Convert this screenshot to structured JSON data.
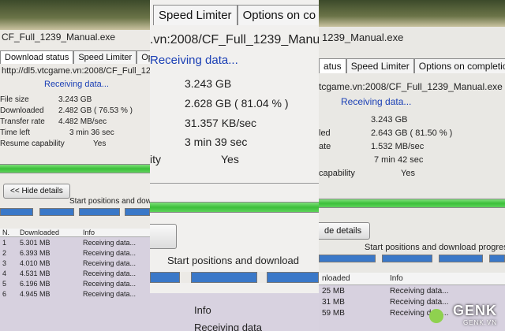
{
  "left": {
    "title": "CF_Full_1239_Manual.exe",
    "tabs": [
      "Download status",
      "Speed Limiter",
      "Options on completion"
    ],
    "url": "http://dl5.vtcgame.vn:2008/CF_Full_1239_Manual",
    "status": "Receiving data...",
    "rows": [
      {
        "label": "File size",
        "value": "3.243 GB"
      },
      {
        "label": "Downloaded",
        "value": "2.482 GB ( 76.53 % )"
      },
      {
        "label": "Transfer rate",
        "value": "4.482 MB/sec"
      },
      {
        "label": "Time left",
        "value": "3 min 36 sec"
      },
      {
        "label": "Resume capability",
        "value": "Yes"
      }
    ],
    "hide_details": "<< Hide details",
    "start_positions": "Start positions and download",
    "table_headers": [
      "N.",
      "Downloaded",
      "Info"
    ],
    "table_rows": [
      {
        "n": "1",
        "downloaded": "5.301 MB",
        "info": "Receiving data..."
      },
      {
        "n": "2",
        "downloaded": "6.393 MB",
        "info": "Receiving data..."
      },
      {
        "n": "3",
        "downloaded": "4.010 MB",
        "info": "Receiving data..."
      },
      {
        "n": "4",
        "downloaded": "4.531 MB",
        "info": "Receiving data..."
      },
      {
        "n": "5",
        "downloaded": "6.196 MB",
        "info": "Receiving data..."
      },
      {
        "n": "6",
        "downloaded": "4.945 MB",
        "info": "Receiving data..."
      }
    ]
  },
  "middle": {
    "tabs": [
      "Speed Limiter",
      "Options on co"
    ],
    "url": ".vn:2008/CF_Full_1239_Manua",
    "status": "Receiving data...",
    "rows": [
      "3.243 GB",
      "2.628 GB ( 81.04 % )",
      "31.357 KB/sec",
      "3 min 39 sec",
      "Yes"
    ],
    "label_fragment": "ity",
    "start_positions": "Start positions and download",
    "info_header": "Info",
    "info_row": "Receiving data"
  },
  "right": {
    "title": "1239_Manual.exe",
    "tabs": [
      "atus",
      "Speed Limiter",
      "Options on completio"
    ],
    "url": "tcgame.vn:2008/CF_Full_1239_Manual.exe",
    "status": "Receiving data...",
    "rows": [
      {
        "label": "",
        "value": "3.243 GB"
      },
      {
        "label": "led",
        "value": "2.643 GB ( 81.50 % )"
      },
      {
        "label": "ate",
        "value": "1.532 MB/sec"
      },
      {
        "label": "",
        "value": "7 min 42 sec"
      },
      {
        "label": "capability",
        "value": "Yes"
      }
    ],
    "hide_details": "de details",
    "start_positions": "Start positions and download progres",
    "table_headers": [
      "nloaded",
      "Info"
    ],
    "table_rows": [
      {
        "downloaded": "25 MB",
        "info": "Receiving data..."
      },
      {
        "downloaded": "31 MB",
        "info": "Receiving data..."
      },
      {
        "downloaded": "59 MB",
        "info": "Receiving data..."
      }
    ]
  },
  "watermark": {
    "brand": "GENK",
    "domain": "GENK.VN"
  }
}
